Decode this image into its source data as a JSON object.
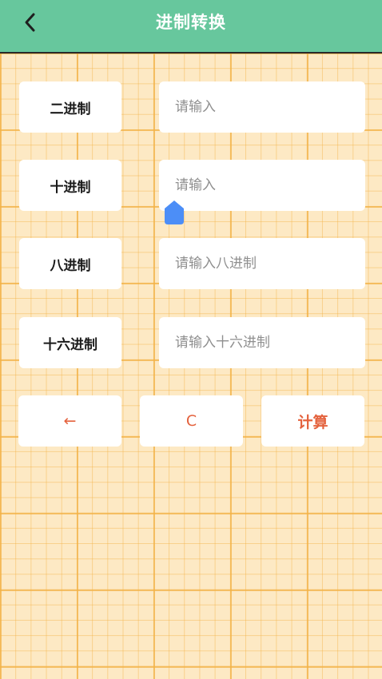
{
  "header": {
    "title": "进制转换",
    "back_icon": "chevron-left-icon"
  },
  "rows": [
    {
      "label": "二进制",
      "value": "",
      "placeholder": "请输入"
    },
    {
      "label": "十进制",
      "value": "",
      "placeholder": "请输入"
    },
    {
      "label": "八进制",
      "value": "",
      "placeholder": "请输入八进制"
    },
    {
      "label": "十六进制",
      "value": "",
      "placeholder": "请输入十六进制"
    }
  ],
  "buttons": {
    "backspace": "←",
    "clear": "C",
    "calculate": "计算"
  },
  "colors": {
    "header": "#67C79D",
    "background": "#FDE9C4",
    "grid": "#F3B246",
    "button_text": "#E4623D",
    "cursor_handle": "#4C8EF7"
  }
}
